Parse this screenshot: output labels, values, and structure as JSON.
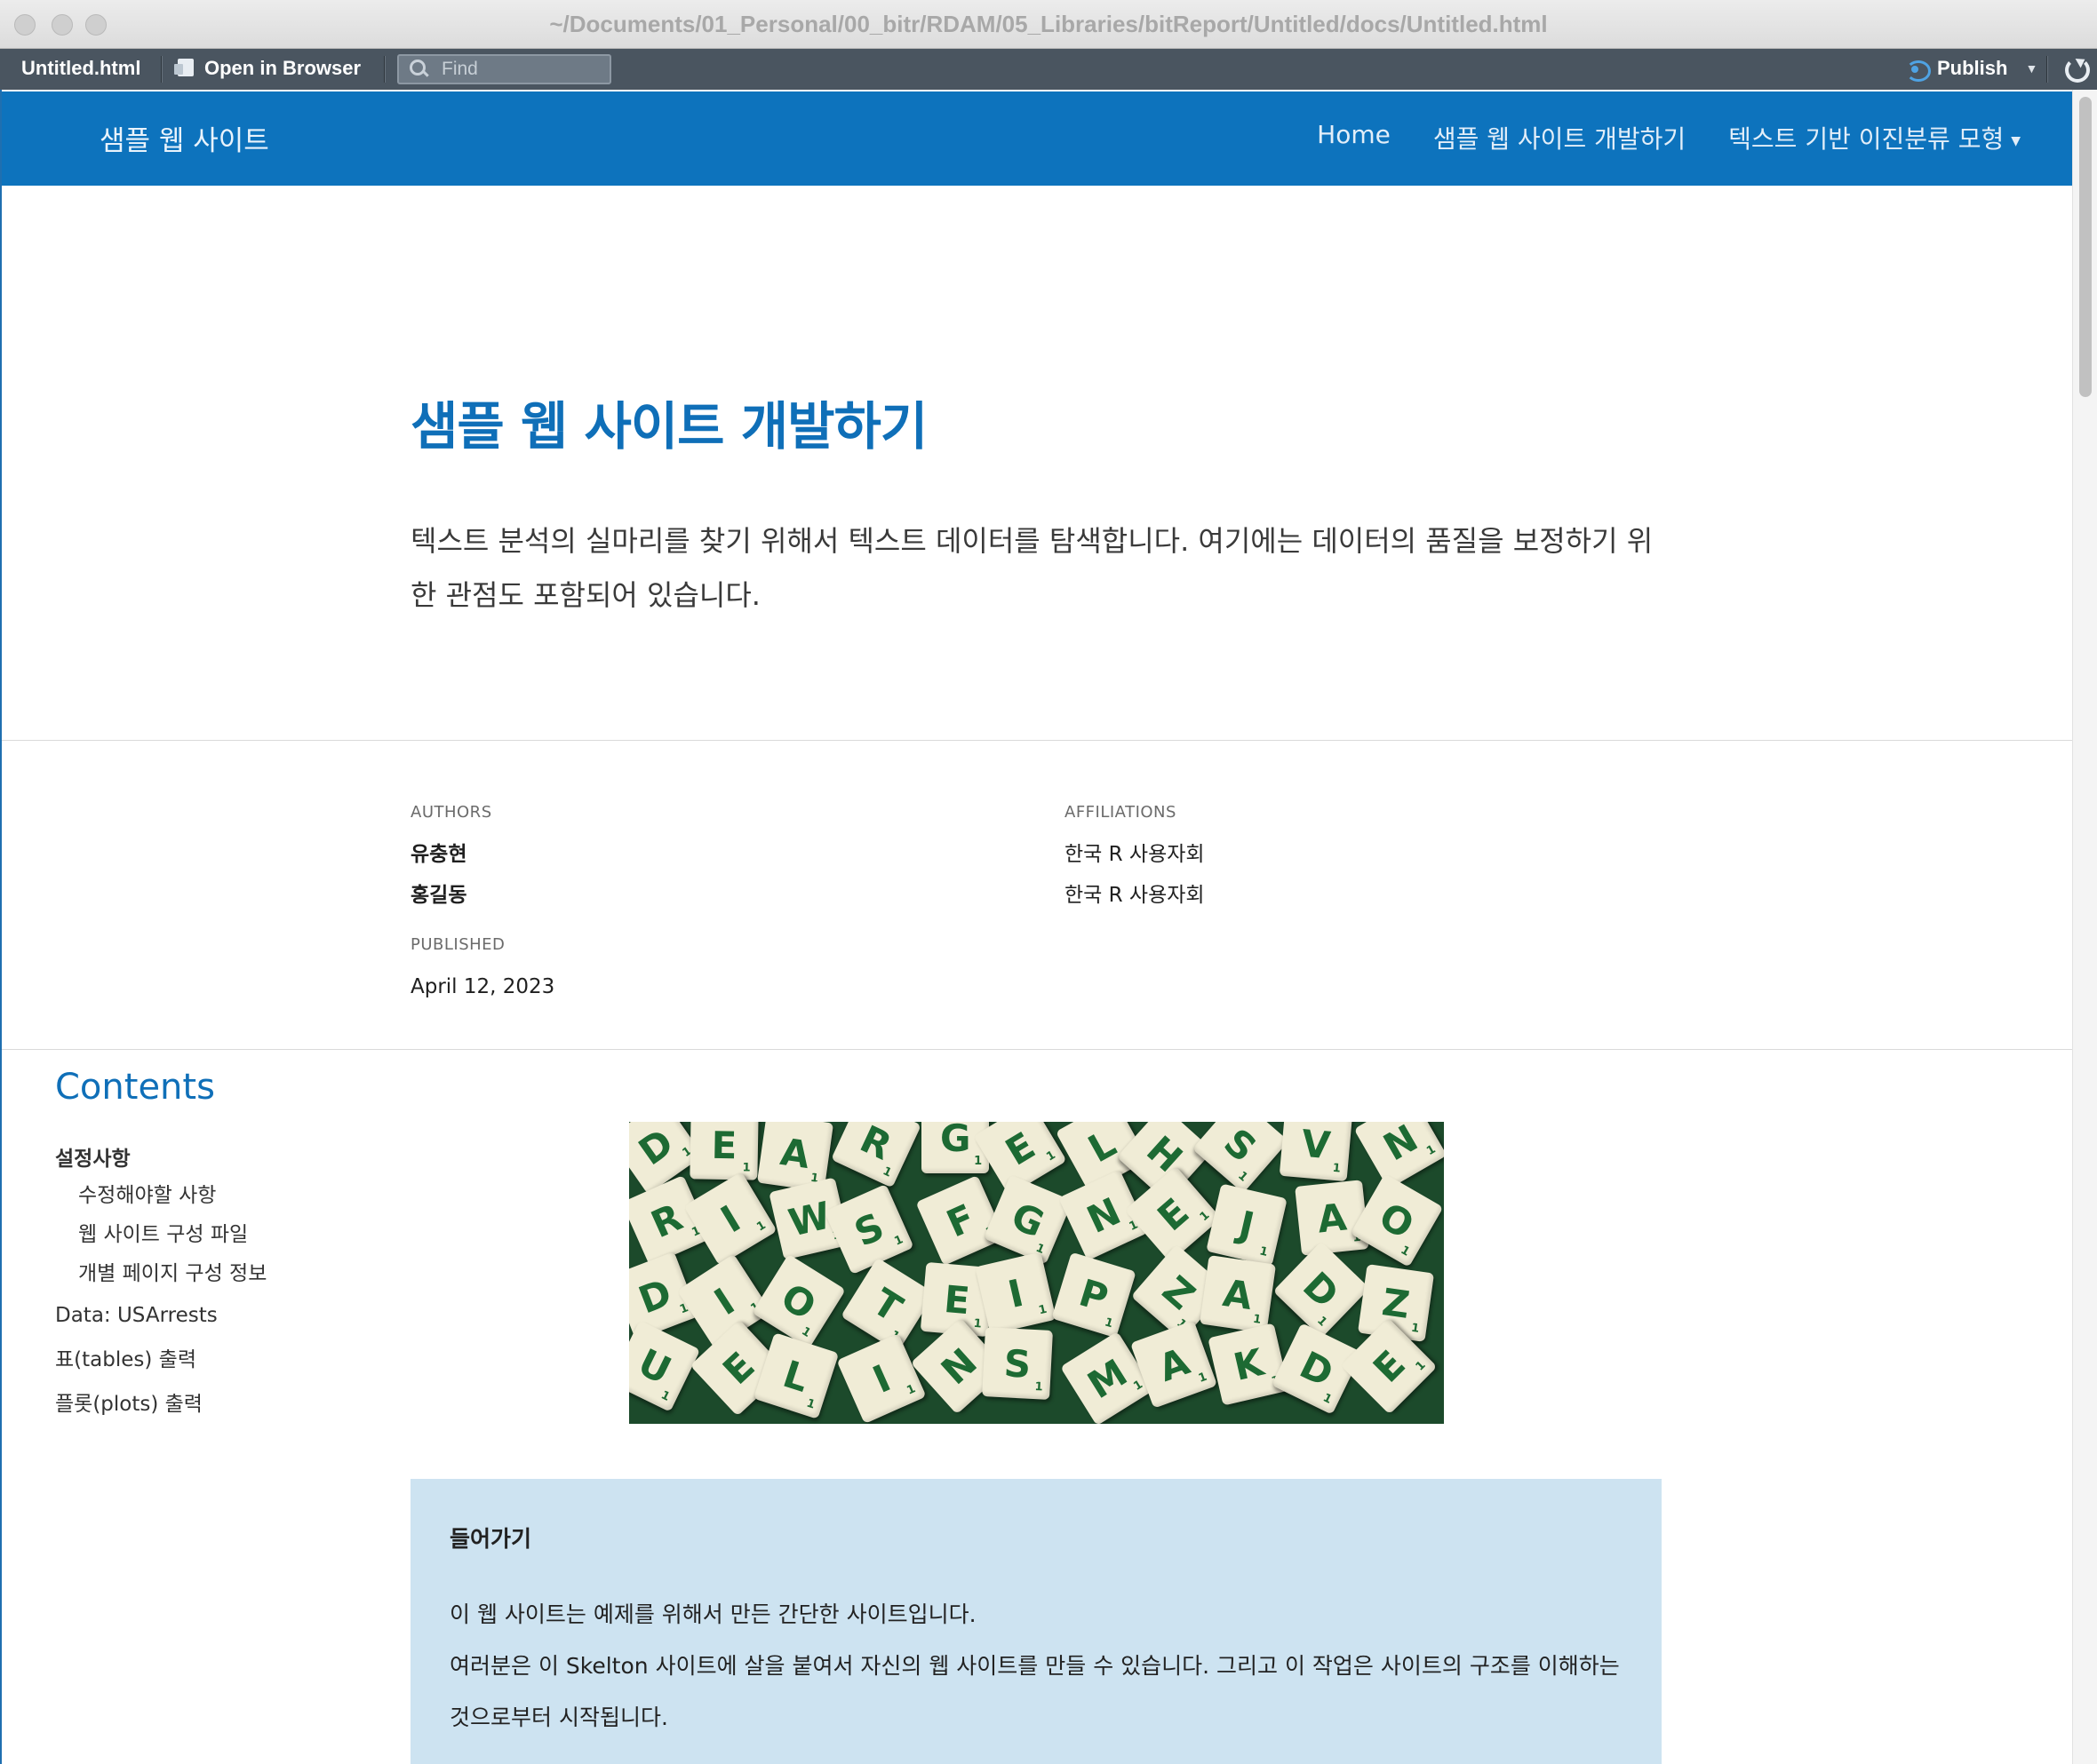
{
  "window": {
    "title": "~/Documents/01_Personal/00_bitr/RDAM/05_Libraries/bitReport/Untitled/docs/Untitled.html"
  },
  "toolbar": {
    "file_name": "Untitled.html",
    "open_in_browser": "Open in Browser",
    "find_placeholder": "Find",
    "publish": "Publish"
  },
  "navbar": {
    "brand": "샘플 웹 사이트",
    "links": [
      "Home",
      "샘플 웹 사이트 개발하기",
      "텍스트 기반 이진분류 모형"
    ]
  },
  "article": {
    "title": "샘플 웹 사이트 개발하기",
    "description": "텍스트 분석의 실마리를 찾기 위해서 텍스트 데이터를 탐색합니다. 여기에는 데이터의 품질을 보정하기 위한 관점도 포함되어 있습니다."
  },
  "byline": {
    "authors_label": "AUTHORS",
    "authors": [
      "유충현",
      "홍길동"
    ],
    "affiliations_label": "AFFILIATIONS",
    "affiliations": [
      "한국 R 사용자회",
      "한국 R 사용자회"
    ],
    "published_label": "PUBLISHED",
    "published": "April 12, 2023"
  },
  "toc": {
    "title": "Contents",
    "items": [
      {
        "label": "설정사항",
        "level": 1
      },
      {
        "label": "수정해야할 사항",
        "level": 2
      },
      {
        "label": "웹 사이트 구성 파일",
        "level": 2
      },
      {
        "label": "개별 페이지 구성 정보",
        "level": 2
      },
      {
        "label": "Data: USArrests",
        "level": 1
      },
      {
        "label": "표(tables) 출력",
        "level": 1
      },
      {
        "label": "플롯(plots) 출력",
        "level": 1
      }
    ]
  },
  "callout": {
    "heading": "들어가기",
    "line1": "이 웹 사이트는 예제를 위해서 만든 간단한 사이트입니다.",
    "line2": "여러분은 이 Skelton 사이트에 살을 붙여서 자신의 웹 사이트를 만들 수 있습니다. 그리고 이 작업은 사이트의 구조를 이해하는 것으로부터 시작됩니다."
  },
  "banner": {
    "tiles": [
      "D",
      "E",
      "A",
      "R",
      "G",
      "E",
      "L",
      "H",
      "S",
      "V",
      "N",
      "R",
      "I",
      "W",
      "S",
      "F",
      "G",
      "N",
      "E",
      "J",
      "A",
      "O",
      "D",
      "I",
      "O",
      "T",
      "E",
      "I",
      "P",
      "Z",
      "A",
      "D",
      "Z",
      "U",
      "E",
      "L",
      "I",
      "N",
      "S",
      "M",
      "A",
      "K"
    ]
  },
  "colors": {
    "navbar_bg": "#0d73bd",
    "title": "#0f6fb8",
    "callout_bg": "#cde3f1",
    "toolbar_bg": "#4a5560"
  }
}
